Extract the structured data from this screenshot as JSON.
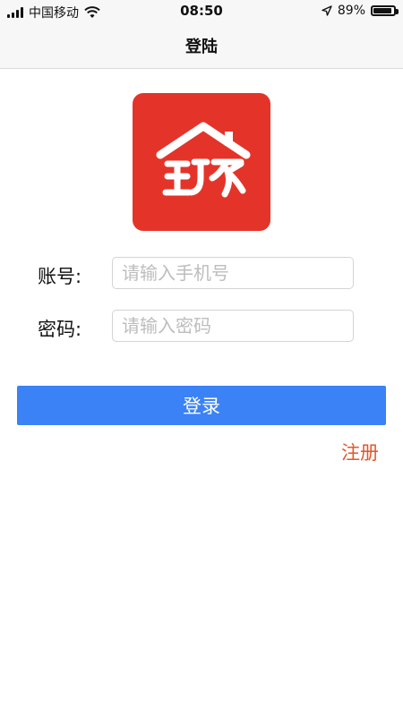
{
  "status_bar": {
    "carrier": "中国移动",
    "time": "08:50",
    "battery_percent": "89%",
    "battery_level": 0.89
  },
  "nav": {
    "title": "登陆"
  },
  "form": {
    "account_label": "账号:",
    "account_placeholder": "请输入手机号",
    "password_label": "密码:",
    "password_placeholder": "请输入密码"
  },
  "actions": {
    "login_label": "登录",
    "register_label": "注册"
  },
  "colors": {
    "brand_red": "#e4342a",
    "primary_blue": "#3a82f6",
    "link_orange": "#e4552a"
  }
}
